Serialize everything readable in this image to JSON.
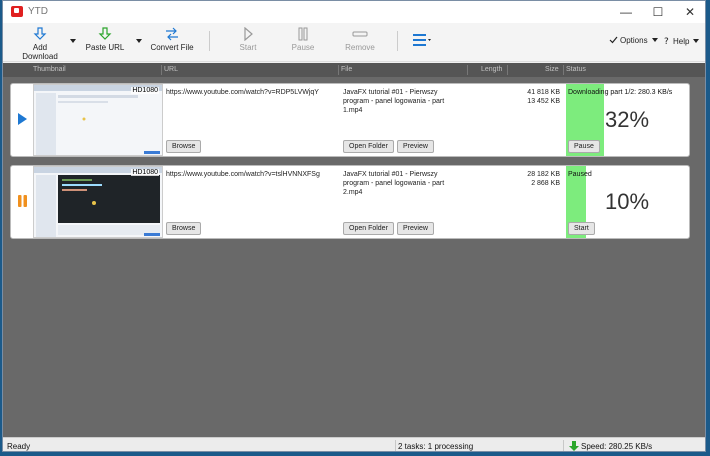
{
  "window": {
    "title": "YTD"
  },
  "toolbar": {
    "add_download": "Add Download",
    "paste_url": "Paste URL",
    "convert_file": "Convert File",
    "start": "Start",
    "pause": "Pause",
    "remove": "Remove",
    "options": "Options",
    "help": "Help"
  },
  "columns": {
    "thumbnail": "Thumbnail",
    "url": "URL",
    "file": "File",
    "length": "Length",
    "size": "Size",
    "status": "Status"
  },
  "downloads": [
    {
      "quality": "HD1080",
      "url": "https://www.youtube.com/watch?v=RDP5LVWjqY",
      "browse_label": "Browse",
      "filename": "JavaFX tutorial #01 - Pierwszy program - panel logowania - part 1.mp4",
      "open_folder_label": "Open Folder",
      "preview_label": "Preview",
      "size_total": "41 818 KB",
      "size_done": "13 452 KB",
      "status": "Downloading part 1/2: 280.3 KB/s",
      "progress_text": "32%",
      "progress": 0.32,
      "action_label": "Pause",
      "state_icon": "play-icon"
    },
    {
      "quality": "HD1080",
      "url": "https://www.youtube.com/watch?v=tslHVNNXFSg",
      "browse_label": "Browse",
      "filename": "JavaFX tutorial #01 - Pierwszy program - panel logowania - part 2.mp4",
      "open_folder_label": "Open Folder",
      "preview_label": "Preview",
      "size_total": "28 182 KB",
      "size_done": "2 868 KB",
      "status": "Paused",
      "progress_text": "10%",
      "progress": 0.1,
      "action_label": "Start",
      "state_icon": "pause-icon"
    }
  ],
  "statusbar": {
    "left": "Ready",
    "center": "2 tasks: 1 processing",
    "speed": "Speed: 280.25 KB/s"
  },
  "colors": {
    "accent": "#1e78d2",
    "progress": "#7dec7d",
    "paused": "#f0901e"
  }
}
